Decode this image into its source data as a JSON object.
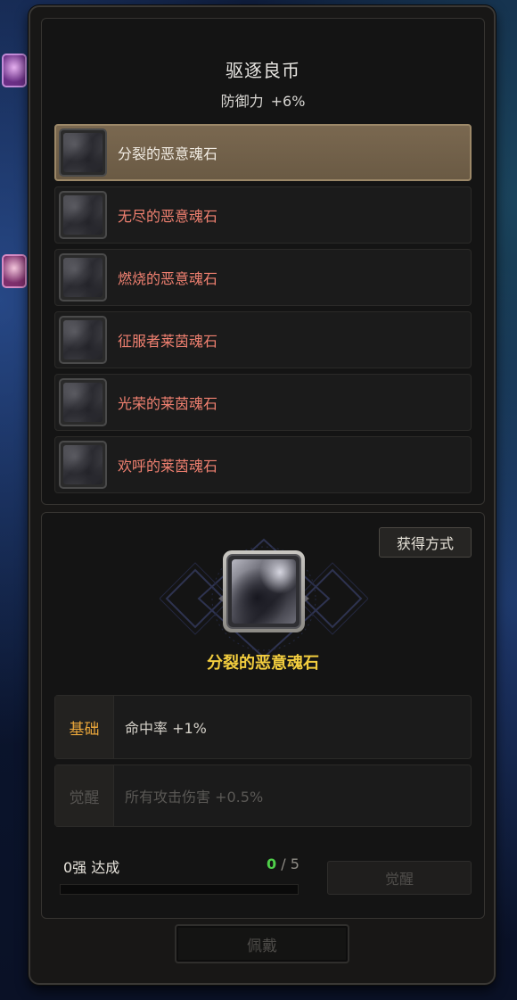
{
  "set": {
    "title": "驱逐良币",
    "bonus_label": "防御力",
    "bonus_value": "+6%"
  },
  "soulstones": [
    {
      "name": "分裂的恶意魂石",
      "selected": true
    },
    {
      "name": "无尽的恶意魂石",
      "selected": false
    },
    {
      "name": "燃烧的恶意魂石",
      "selected": false
    },
    {
      "name": "征服者莱茵魂石",
      "selected": false
    },
    {
      "name": "光荣的莱茵魂石",
      "selected": false
    },
    {
      "name": "欢呼的莱茵魂石",
      "selected": false
    }
  ],
  "detail": {
    "source_button": "获得方式",
    "selected_name": "分裂的恶意魂石",
    "stats": [
      {
        "tag": "基础",
        "text": "命中率 +1%",
        "active": true
      },
      {
        "tag": "觉醒",
        "text": "所有攻击伤害 +0.5%",
        "active": false
      }
    ],
    "progress_label": "0强 达成",
    "progress_current": "0",
    "progress_sep": "/",
    "progress_max": "5",
    "progress_fraction": 0,
    "awaken_button": "觉醒"
  },
  "wear_button": "佩戴",
  "colors": {
    "accent_gold": "#f2cd3e",
    "item_red": "#f08070",
    "base_tag_orange": "#e8a53a",
    "progress_green": "#4fcf4a",
    "selected_row": "#7a6850"
  },
  "icons": {
    "soulstone": "dark-soulstone-icon",
    "emblem": "diamond-frame-emblem"
  }
}
